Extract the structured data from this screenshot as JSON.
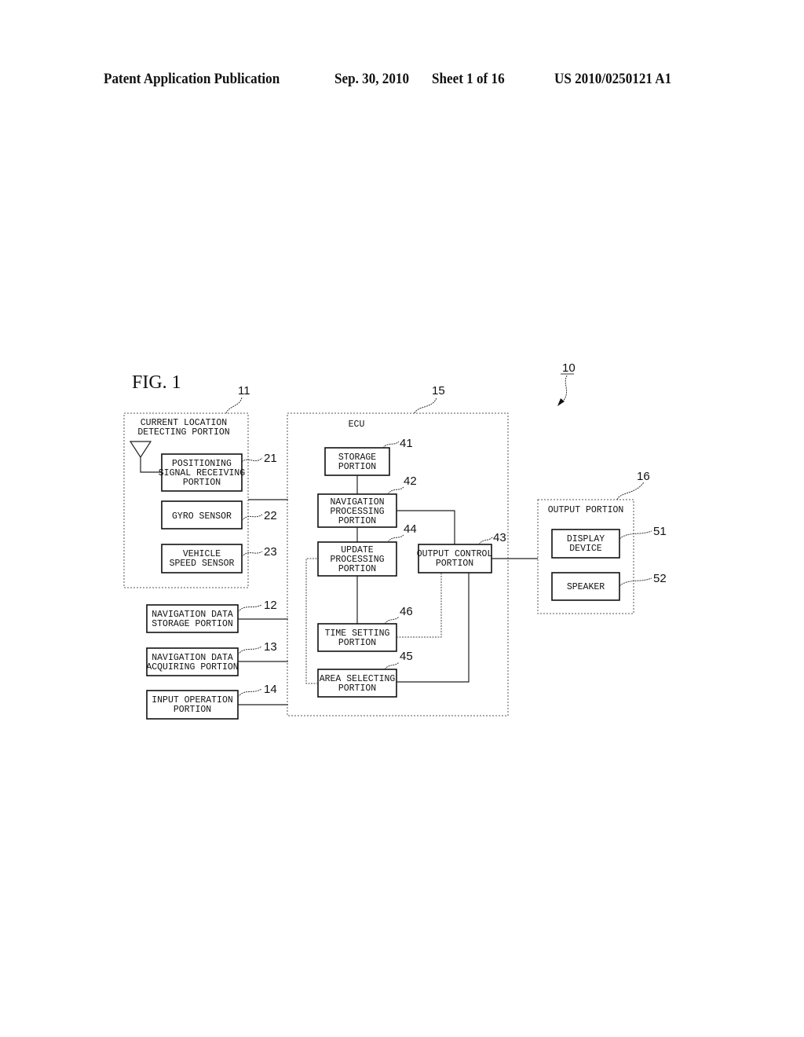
{
  "header": {
    "publication": "Patent Application Publication",
    "date": "Sep. 30, 2010",
    "sheet": "Sheet 1 of 16",
    "number": "US 2010/0250121 A1"
  },
  "figure": {
    "label": "FIG. 1",
    "system_ref": "10",
    "groups": {
      "current_location": {
        "ref": "11",
        "title_line1": "CURRENT LOCATION",
        "title_line2": "DETECTING PORTION"
      },
      "ecu": {
        "ref": "15",
        "title": "ECU"
      },
      "output": {
        "ref": "16",
        "title": "OUTPUT PORTION"
      }
    },
    "blocks": {
      "positioning": {
        "ref": "21",
        "lines": [
          "POSITIONING",
          "SIGNAL RECEIVING",
          "PORTION"
        ]
      },
      "gyro": {
        "ref": "22",
        "lines": [
          "GYRO SENSOR"
        ]
      },
      "vehicle_speed": {
        "ref": "23",
        "lines": [
          "VEHICLE",
          "SPEED SENSOR"
        ]
      },
      "nav_storage": {
        "ref": "12",
        "lines": [
          "NAVIGATION DATA",
          "STORAGE PORTION"
        ]
      },
      "nav_acquiring": {
        "ref": "13",
        "lines": [
          "NAVIGATION DATA",
          "ACQUIRING PORTION"
        ]
      },
      "input_operation": {
        "ref": "14",
        "lines": [
          "INPUT OPERATION",
          "PORTION"
        ]
      },
      "storage": {
        "ref": "41",
        "lines": [
          "STORAGE",
          "PORTION"
        ]
      },
      "nav_processing": {
        "ref": "42",
        "lines": [
          "NAVIGATION",
          "PROCESSING",
          "PORTION"
        ]
      },
      "update_processing": {
        "ref": "44",
        "lines": [
          "UPDATE",
          "PROCESSING",
          "PORTION"
        ]
      },
      "output_control": {
        "ref": "43",
        "lines": [
          "OUTPUT CONTROL",
          "PORTION"
        ]
      },
      "time_setting": {
        "ref": "46",
        "lines": [
          "TIME SETTING",
          "PORTION"
        ]
      },
      "area_selecting": {
        "ref": "45",
        "lines": [
          "AREA SELECTING",
          "PORTION"
        ]
      },
      "display": {
        "ref": "51",
        "lines": [
          "DISPLAY",
          "DEVICE"
        ]
      },
      "speaker": {
        "ref": "52",
        "lines": [
          "SPEAKER"
        ]
      }
    }
  }
}
